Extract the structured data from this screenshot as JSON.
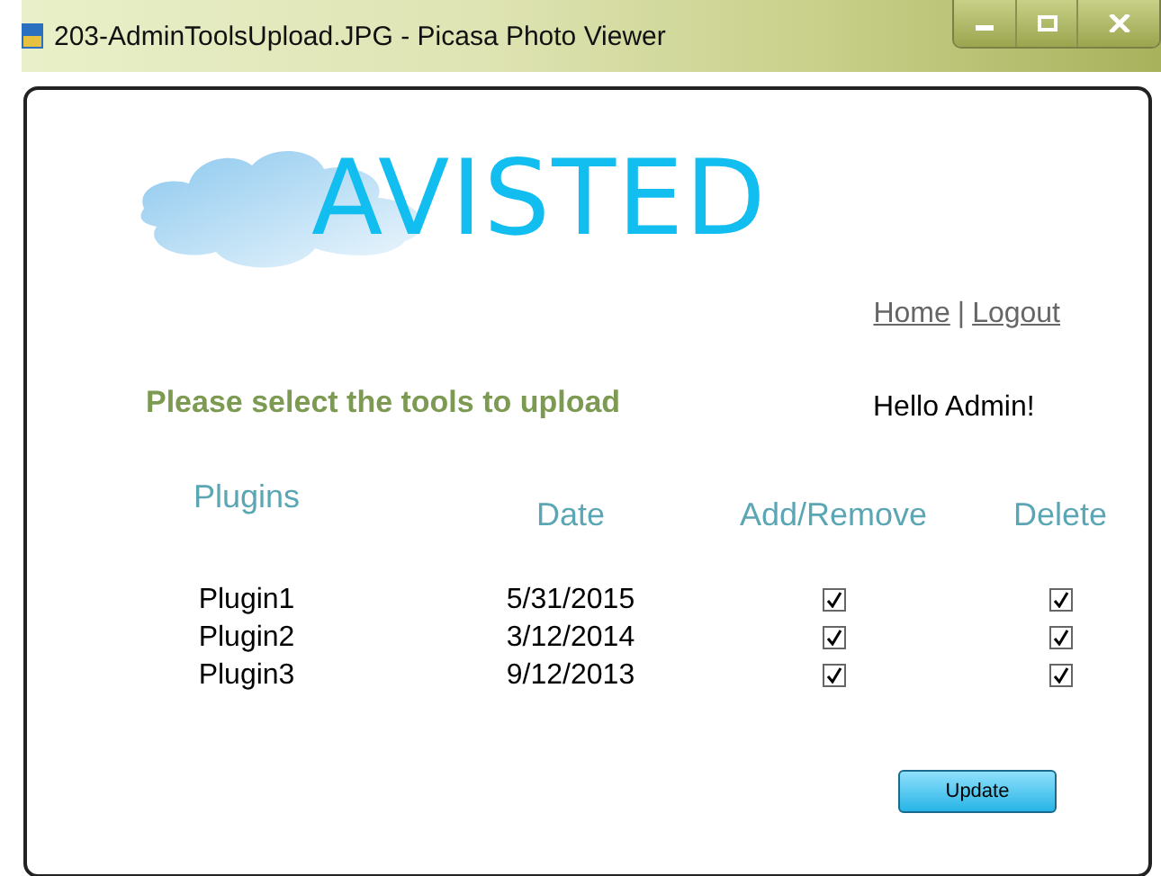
{
  "window": {
    "title": "203-AdminToolsUpload.JPG - Picasa Photo Viewer"
  },
  "logo": {
    "text": "AVISTED"
  },
  "nav": {
    "links": [
      "Home",
      "Logout"
    ],
    "separator": "|"
  },
  "heading": "Please select the tools to upload",
  "greeting": "Hello Admin!",
  "table": {
    "columns": [
      "Plugins",
      "Date",
      "Add/Remove",
      "Delete"
    ],
    "rows": [
      {
        "name": "Plugin1",
        "date": "5/31/2015",
        "add": true,
        "delete": true
      },
      {
        "name": "Plugin2",
        "date": "3/12/2014",
        "add": true,
        "delete": true
      },
      {
        "name": "Plugin3",
        "date": "9/12/2013",
        "add": true,
        "delete": true
      }
    ]
  },
  "buttons": [
    "Update"
  ]
}
